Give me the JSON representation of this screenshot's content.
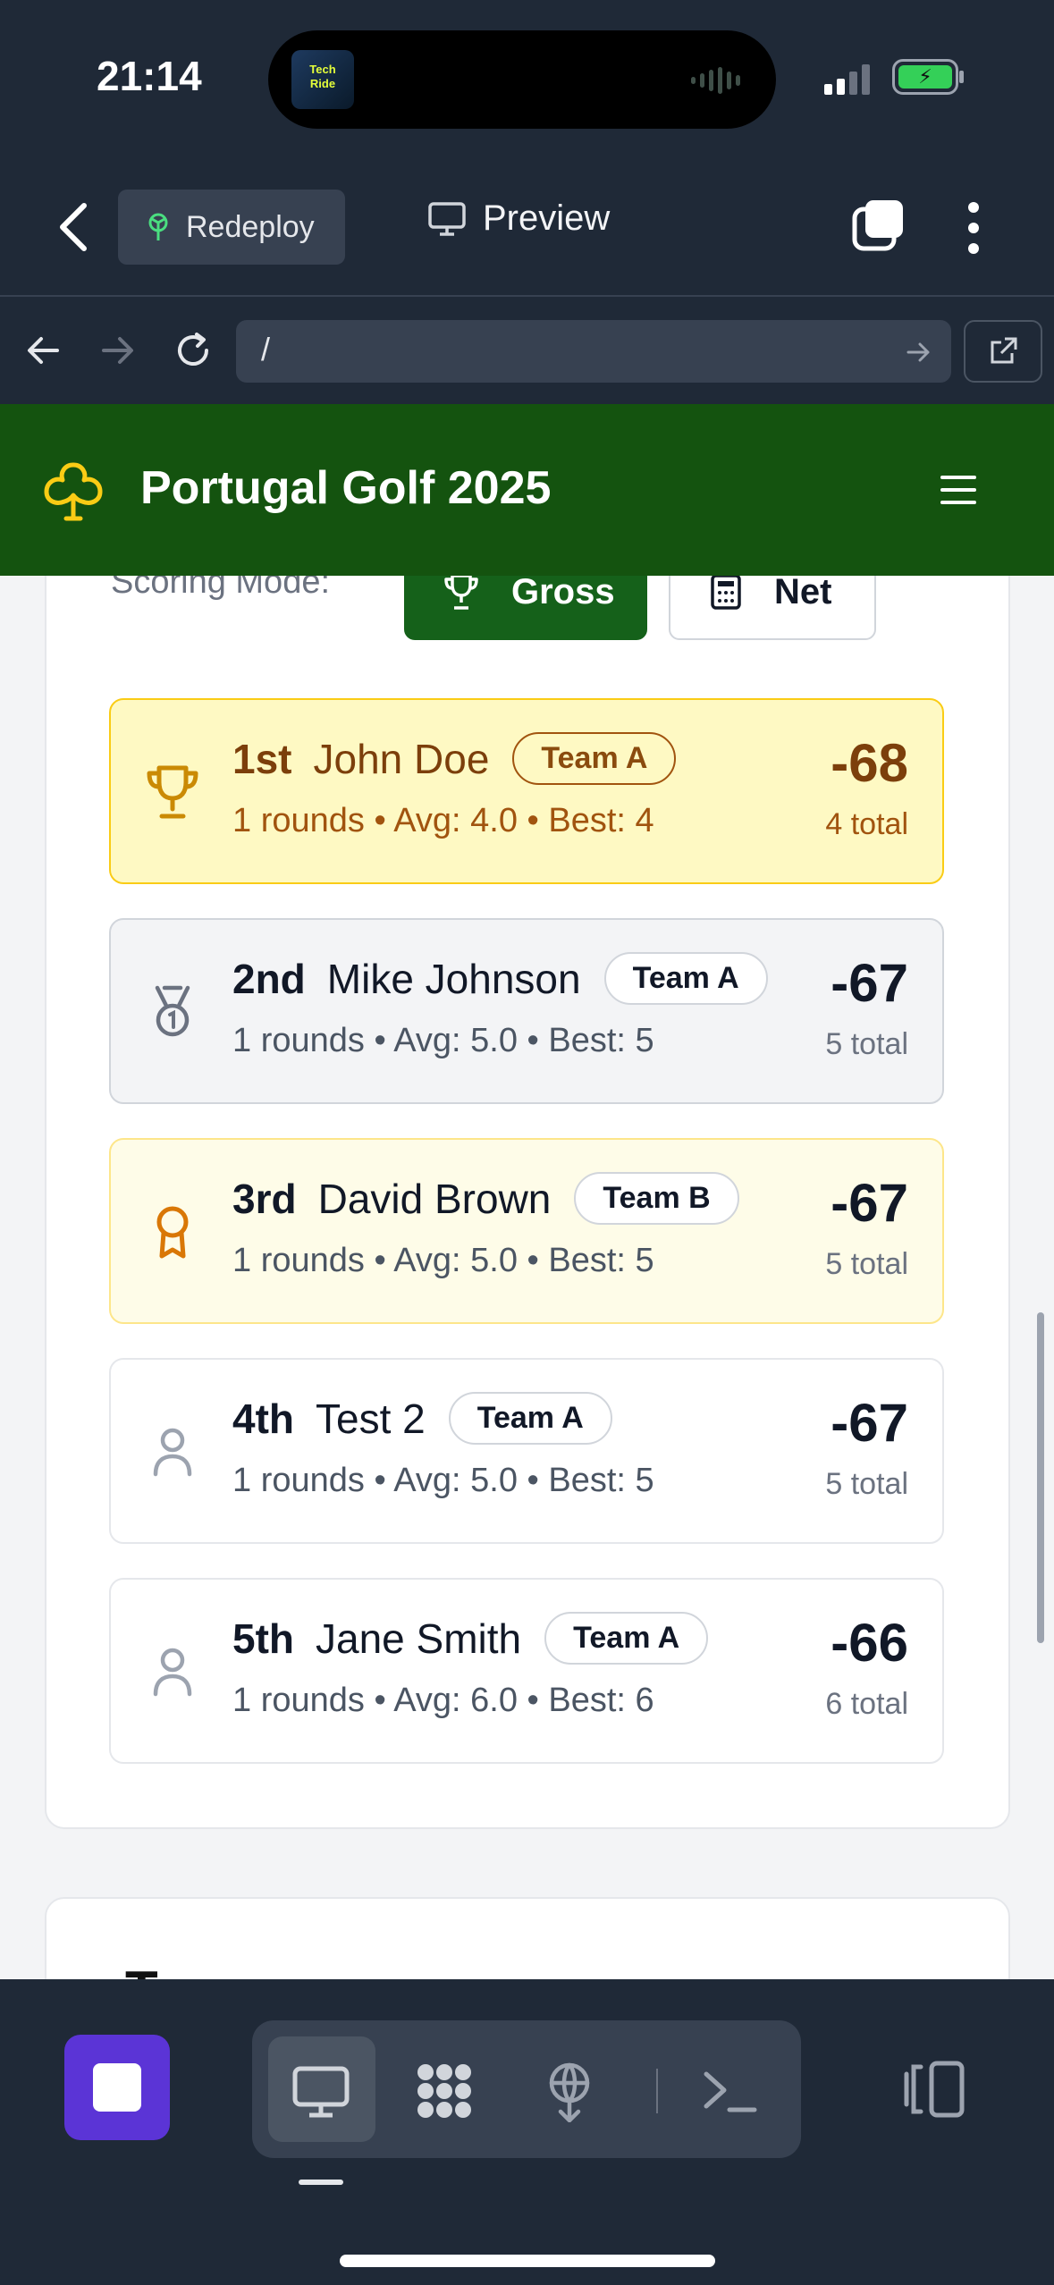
{
  "status_bar": {
    "time": "21:14",
    "now_playing_art": "Techmeme Ride Home"
  },
  "ide": {
    "redeploy_label": "Redeploy",
    "preview_label": "Preview",
    "url": "/"
  },
  "app": {
    "title": "Portugal Golf 2025"
  },
  "scoring": {
    "label": "Scoring Mode:",
    "modes": [
      {
        "label": "Gross",
        "active": true
      },
      {
        "label": "Net",
        "active": false
      }
    ]
  },
  "leaderboard": [
    {
      "position": "1st",
      "name": "John Doe",
      "team": "Team A",
      "rounds": "1 rounds",
      "avg": "Avg: 4.0",
      "best": "Best: 4",
      "score": "-68",
      "total": "4 total",
      "icon": "trophy-icon"
    },
    {
      "position": "2nd",
      "name": "Mike Johnson",
      "team": "Team A",
      "rounds": "1 rounds",
      "avg": "Avg: 5.0",
      "best": "Best: 5",
      "score": "-67",
      "total": "5 total",
      "icon": "medal-icon"
    },
    {
      "position": "3rd",
      "name": "David Brown",
      "team": "Team B",
      "rounds": "1 rounds",
      "avg": "Avg: 5.0",
      "best": "Best: 5",
      "score": "-67",
      "total": "5 total",
      "icon": "award-icon"
    },
    {
      "position": "4th",
      "name": "Test 2",
      "team": "Team A",
      "rounds": "1 rounds",
      "avg": "Avg: 5.0",
      "best": "Best: 5",
      "score": "-67",
      "total": "5 total",
      "icon": "user-icon"
    },
    {
      "position": "5th",
      "name": "Jane Smith",
      "team": "Team A",
      "rounds": "1 rounds",
      "avg": "Avg: 6.0",
      "best": "Best: 6",
      "score": "-66",
      "total": "6 total",
      "icon": "user-icon"
    }
  ],
  "next_card_heading": "T",
  "colors": {
    "header_green": "#14530f",
    "gross_active": "#15611a",
    "gold": "#facc15",
    "dock_accent": "#5b34d6"
  }
}
